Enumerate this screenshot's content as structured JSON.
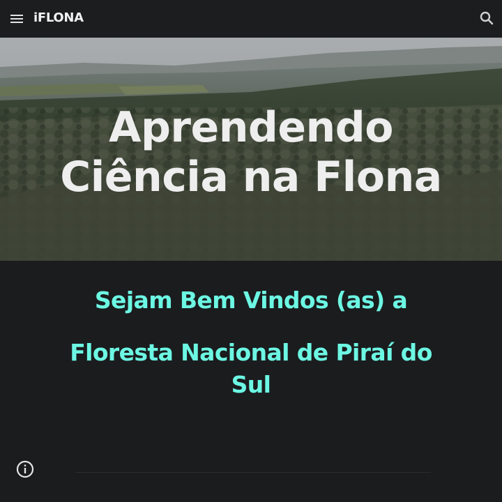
{
  "header": {
    "brand": "iFLONA",
    "menu_icon": "hamburger-menu-icon",
    "search_icon": "search-icon"
  },
  "hero": {
    "title_line1": "Aprendendo",
    "title_line2": "Ciência na Flona",
    "background": "forest-landscape-photo"
  },
  "main": {
    "welcome_line": "Sejam Bem Vindos (as) a",
    "subtitle_line1": "Floresta Nacional de Piraí do",
    "subtitle_line2": "Sul"
  },
  "footer": {
    "info_icon": "info-icon"
  },
  "colors": {
    "background": "#1b1c1e",
    "header_bg": "#1c1d1f",
    "accent": "#6cf7e3",
    "hero_text": "#eeeeee"
  }
}
